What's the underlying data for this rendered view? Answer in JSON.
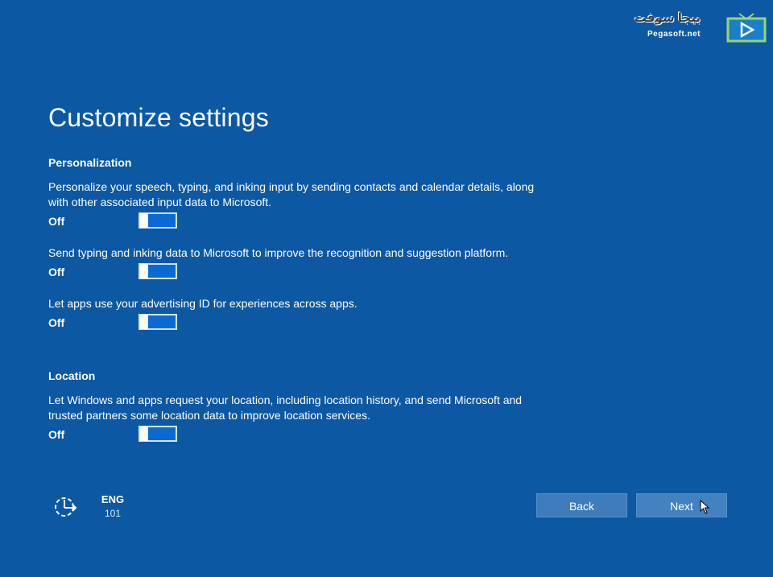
{
  "watermark": {
    "brand_text": "بيجا سوفت",
    "site": "Pegasoft.net",
    "icon": "tv-play-icon"
  },
  "page": {
    "title": "Customize settings"
  },
  "personalization": {
    "heading": "Personalization",
    "settings": [
      {
        "description": "Personalize your speech, typing, and inking input by sending contacts and calendar details, along with other associated input data to Microsoft.",
        "state_label": "Off",
        "on": false
      },
      {
        "description": "Send typing and inking data to Microsoft to improve the recognition and suggestion platform.",
        "state_label": "Off",
        "on": false
      },
      {
        "description": "Let apps use your advertising ID for experiences across apps.",
        "state_label": "Off",
        "on": false
      }
    ]
  },
  "location": {
    "heading": "Location",
    "settings": [
      {
        "description": "Let Windows and apps request your location, including location history, and send Microsoft and trusted partners some location data to improve location services.",
        "state_label": "Off",
        "on": false
      }
    ]
  },
  "footer": {
    "accessibility_icon": "ease-of-access-icon",
    "language_code": "ENG",
    "keyboard_layout": "101",
    "back_label": "Back",
    "next_label": "Next"
  },
  "colors": {
    "background": "#0c58a3",
    "toggle_fill": "#0a6ad2",
    "button": "#3e7cbc",
    "text": "#ffffff"
  }
}
